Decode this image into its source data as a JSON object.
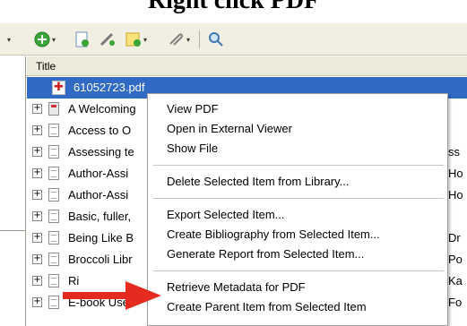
{
  "caption": "Right click PDF",
  "toolbar": {
    "buttons": [
      {
        "icon": "add-circle-icon"
      },
      {
        "icon": "new-item-icon"
      },
      {
        "icon": "link-icon"
      },
      {
        "icon": "note-icon"
      },
      {
        "icon": "attachment-icon"
      },
      {
        "icon": "search-icon"
      }
    ]
  },
  "header": {
    "title_column": "Title"
  },
  "rows": [
    {
      "title": "61052723.pdf",
      "type": "pdf",
      "selected": true
    },
    {
      "title": "A Welcoming",
      "type": "book",
      "right": ""
    },
    {
      "title": "Access to O",
      "type": "doc",
      "right": ""
    },
    {
      "title": "Assessing te",
      "type": "doc",
      "right": "ss"
    },
    {
      "title": "Author-Assi",
      "type": "doc",
      "right": "Ho"
    },
    {
      "title": "Author-Assi",
      "type": "doc",
      "right": "Ho"
    },
    {
      "title": "Basic, fuller,",
      "type": "doc",
      "right": ""
    },
    {
      "title": "Being Like B",
      "type": "doc",
      "right": "Dr"
    },
    {
      "title": "Broccoli Libr",
      "type": "doc",
      "right": "Po"
    },
    {
      "title": "Ri",
      "type": "doc",
      "right": "Ka"
    },
    {
      "title": "E-book Use",
      "type": "doc",
      "right": "Fo"
    }
  ],
  "context_menu": {
    "group1": [
      "View PDF",
      "Open in External Viewer",
      "Show File"
    ],
    "group2": [
      "Delete Selected Item from Library..."
    ],
    "group3": [
      "Export Selected Item...",
      "Create Bibliography from Selected Item...",
      "Generate Report from Selected Item..."
    ],
    "group4": [
      "Retrieve Metadata for PDF",
      "Create Parent Item from Selected Item"
    ]
  },
  "colors": {
    "selection": "#316ac5",
    "toolbar_bg": "#f1efe2",
    "arrow": "#e52b1f"
  }
}
